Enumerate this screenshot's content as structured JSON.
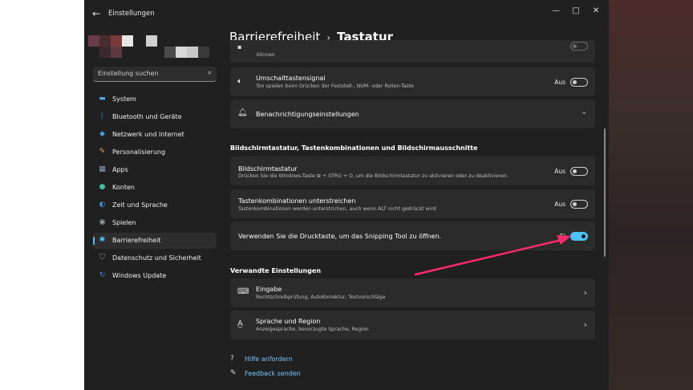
{
  "window": {
    "title": "Einstellungen",
    "back_glyph": "←",
    "minimize_glyph": "—",
    "maximize_glyph": "□",
    "close_glyph": "✕"
  },
  "search": {
    "placeholder": "Einstellung suchen",
    "icon": "search-icon"
  },
  "sidebar": {
    "items": [
      {
        "label": "System",
        "icon": "monitor-icon",
        "color": "#4aa8e8"
      },
      {
        "label": "Bluetooth und Geräte",
        "icon": "bluetooth-icon",
        "color": "#2b7fd8"
      },
      {
        "label": "Netzwerk und Internet",
        "icon": "wifi-icon",
        "color": "#3aa0f0"
      },
      {
        "label": "Personalisierung",
        "icon": "brush-icon",
        "color": "#e8a060"
      },
      {
        "label": "Apps",
        "icon": "apps-icon",
        "color": "#8aa0c0"
      },
      {
        "label": "Konten",
        "icon": "person-icon",
        "color": "#3cc0a0"
      },
      {
        "label": "Zeit und Sprache",
        "icon": "globe-clock-icon",
        "color": "#3a90e0"
      },
      {
        "label": "Spielen",
        "icon": "gamepad-icon",
        "color": "#9aa0a8"
      },
      {
        "label": "Barrierefreiheit",
        "icon": "accessibility-icon",
        "color": "#4cc2ff",
        "active": true
      },
      {
        "label": "Datenschutz und Sicherheit",
        "icon": "shield-icon",
        "color": "#8a94a0"
      },
      {
        "label": "Windows Update",
        "icon": "update-icon",
        "color": "#2f8ae0"
      }
    ]
  },
  "breadcrumb": {
    "parent": "Barrierefreiheit",
    "separator": "›",
    "current": "Tastatur"
  },
  "top_partial": {
    "subtitle": "können"
  },
  "cards": {
    "umschalt": {
      "title": "Umschalttastensignal",
      "subtitle": "Ton spielen beim Drücken der Feststell-, NUM- oder Rollen-Taste",
      "state_label": "Aus",
      "icon": "speaker-icon",
      "on": false
    },
    "benachrichtigung": {
      "title": "Benachrichtigungseinstellungen",
      "icon": "bell-icon",
      "chevron": "⌄"
    },
    "bildschirmtastatur": {
      "title": "Bildschirmtastatur",
      "subtitle": "Drücken Sie die Windows-Taste ⊞ + STRG + O, um die Bildschirmtastatur zu aktivieren oder zu deaktivieren.",
      "state_label": "Aus",
      "on": false
    },
    "unterstreichen": {
      "title": "Tastenkombinationen unterstreichen",
      "subtitle": "Tastenkombinationen werden unterstrichen, auch wenn ALT nicht gedrückt wird",
      "state_label": "Aus",
      "on": false
    },
    "drucktaste": {
      "title": "Verwenden Sie die Drucktaste, um das Snipping Tool zu öffnen.",
      "state_label": "Ei",
      "on": true
    },
    "eingabe": {
      "title": "Eingabe",
      "subtitle": "Rechtschreibprüfung, AutoKorrektur, Textvorschläge",
      "icon": "keyboard-icon",
      "chevron": "›"
    },
    "sprache": {
      "title": "Sprache und Region",
      "subtitle": "Anzeigesprache, bevorzugte Sprache, Region",
      "icon": "language-icon",
      "chevron": "›"
    }
  },
  "sections": {
    "bildschirm": "Bildschirmtastatur, Tastenkombinationen und Bildschirmausschnitte",
    "verwandt": "Verwandte Einstellungen"
  },
  "links": {
    "hilfe": "Hilfe anfordern",
    "feedback": "Feedback senden"
  },
  "colors": {
    "accent": "#4cc2ff",
    "annotation_arrow": "#ff2a6d"
  }
}
